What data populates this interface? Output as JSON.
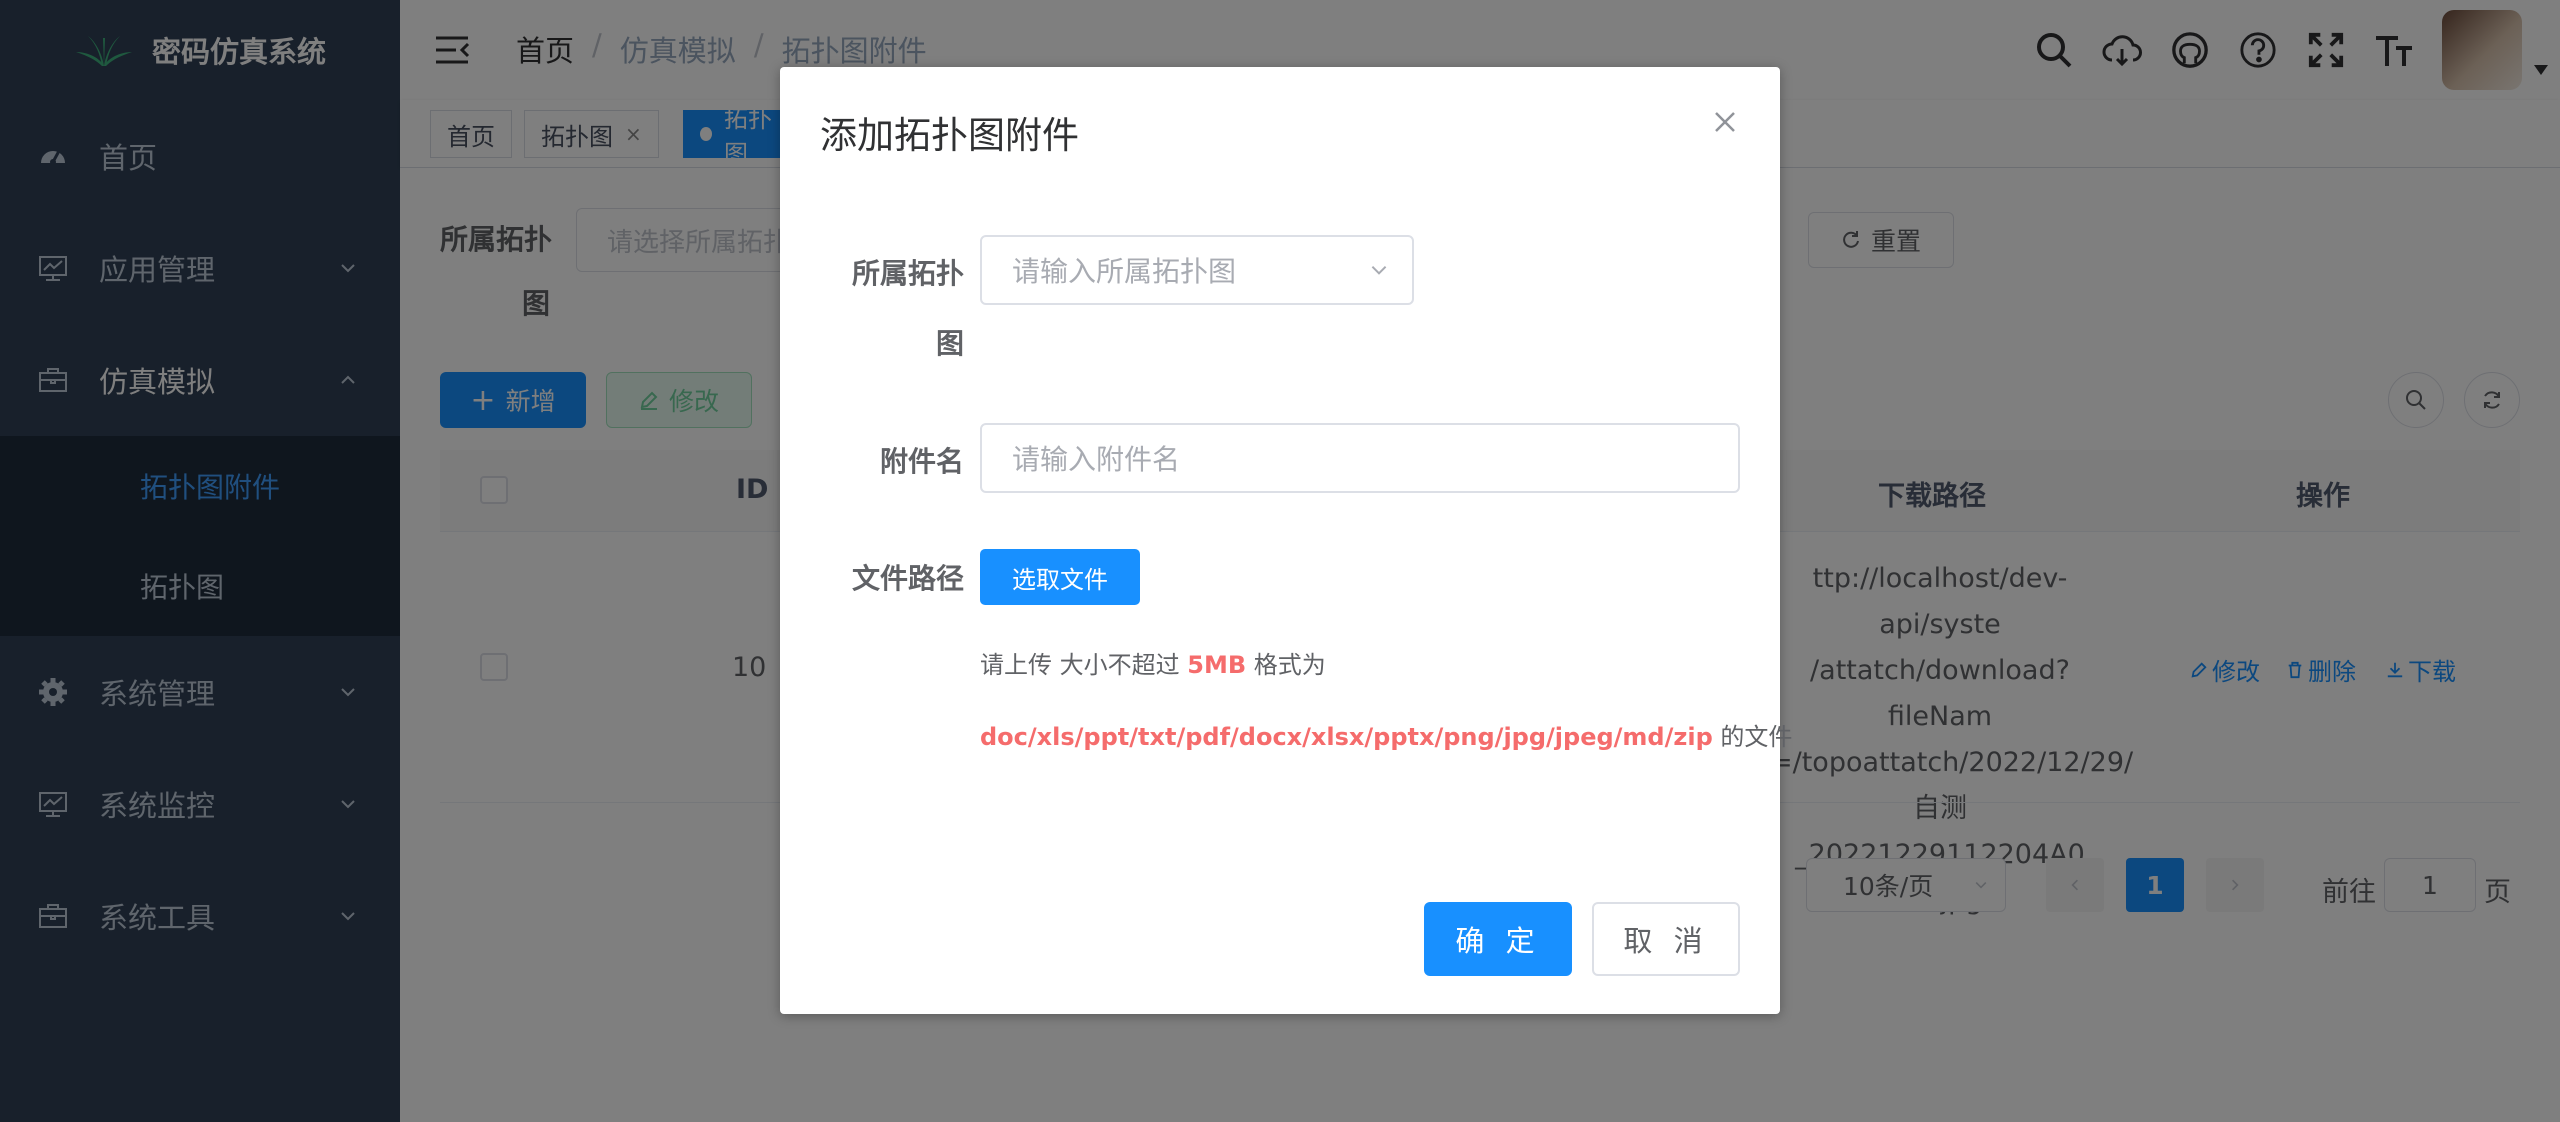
{
  "app": {
    "title": "密码仿真系统"
  },
  "sidebar": {
    "items": [
      {
        "label": "首页",
        "icon": "dashboard-icon"
      },
      {
        "label": "应用管理",
        "icon": "monitor-icon"
      },
      {
        "label": "仿真模拟",
        "icon": "briefcase-icon"
      },
      {
        "label": "系统管理",
        "icon": "gear-icon"
      },
      {
        "label": "系统监控",
        "icon": "monitor-icon"
      },
      {
        "label": "系统工具",
        "icon": "briefcase-icon"
      }
    ],
    "submenu": [
      {
        "label": "拓扑图附件",
        "active": true
      },
      {
        "label": "拓扑图"
      }
    ]
  },
  "navbar": {
    "breadcrumb": [
      "首页",
      "仿真模拟",
      "拓扑图附件"
    ]
  },
  "tags": [
    {
      "label": "首页"
    },
    {
      "label": "拓扑图",
      "close": "×"
    },
    {
      "label": "拓扑图",
      "active": true
    }
  ],
  "search": {
    "topology_label_line1": "所属拓扑",
    "topology_label_line2": "图",
    "topology_placeholder": "请选择所属拓扑图",
    "reset_label": "重置"
  },
  "toolbar": {
    "add_label": "新增",
    "edit_label": "修改"
  },
  "table": {
    "columns": [
      "ID",
      "下载路径",
      "操作"
    ],
    "rows": [
      {
        "id": "10",
        "path_lines": [
          "ttp://localhost/dev-api/syste",
          "/attatch/download?fileNam",
          "=/topoattatch/2022/12/29/",
          "自测_20221229112204A0",
          "01.jpg"
        ],
        "actions": [
          "修改",
          "删除",
          "下载"
        ]
      }
    ]
  },
  "pagination": {
    "page_size": "10条/页",
    "current_page": "1",
    "goto_label": "前往",
    "goto_value": "1",
    "page_suffix": "页"
  },
  "dialog": {
    "title": "添加拓扑图附件",
    "topology_label_line1": "所属拓扑",
    "topology_label_line2": "图",
    "topology_placeholder": "请输入所属拓扑图",
    "name_label": "附件名",
    "name_placeholder": "请输入附件名",
    "file_label": "文件路径",
    "upload_button": "选取文件",
    "tip_prefix": "请上传 大小不超过",
    "tip_size": "5MB",
    "tip_format_prefix": "格式为",
    "tip_formats": "doc/xls/ppt/txt/pdf/docx/xlsx/pptx/png/jpg/jpeg/md/zip",
    "tip_suffix": "的文件",
    "confirm_label": "确 定",
    "cancel_label": "取 消"
  },
  "colors": {
    "sidebar_bg": "#304156",
    "primary": "#1890ff",
    "danger": "#f56c6c"
  }
}
